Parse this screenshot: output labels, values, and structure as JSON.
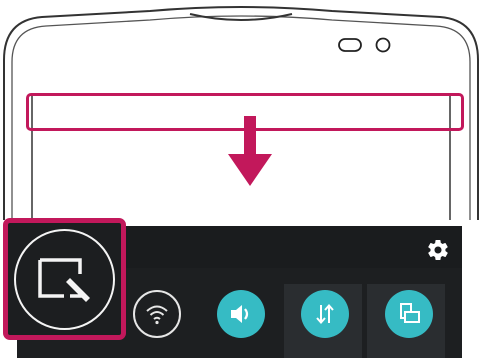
{
  "colors": {
    "highlight": "#c2185b",
    "accent": "#36bbc4",
    "panel": "#1d1f21",
    "outline": "#333333"
  },
  "phone": {
    "icons": [
      "earpiece-slot",
      "front-camera-oval",
      "front-sensor-circle"
    ]
  },
  "gesture": {
    "direction": "down",
    "target": "status-bar"
  },
  "quick_settings": {
    "header_icons": [
      "gear-icon"
    ],
    "toggles": [
      {
        "id": "qslide",
        "icon": "qslide-window-icon",
        "state": "highlighted"
      },
      {
        "id": "wifi",
        "icon": "wifi-icon",
        "state": "off"
      },
      {
        "id": "sound",
        "icon": "speaker-icon",
        "state": "on"
      },
      {
        "id": "data",
        "icon": "data-arrows-icon",
        "state": "on"
      },
      {
        "id": "rotation",
        "icon": "screen-rotation-icon",
        "state": "on"
      }
    ]
  }
}
